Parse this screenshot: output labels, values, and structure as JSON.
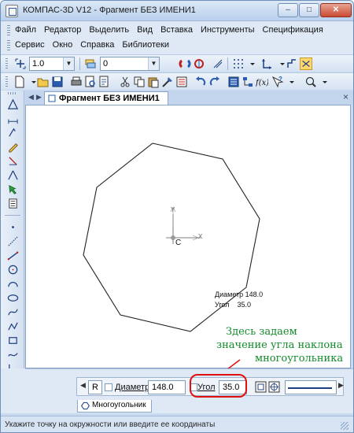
{
  "window": {
    "title": "КОМПАС-3D V12 - Фрагмент БЕЗ ИМЕНИ1",
    "minimize": "–",
    "maximize": "□",
    "close": "✕"
  },
  "menu": {
    "row1": [
      "Файл",
      "Редактор",
      "Выделить",
      "Вид",
      "Вставка",
      "Инструменты",
      "Спецификация"
    ],
    "row2": [
      "Сервис",
      "Окно",
      "Справка",
      "Библиотеки"
    ]
  },
  "toolbar": {
    "line_width": "1.0",
    "layer": "0"
  },
  "document": {
    "tab_label": "Фрагмент БЕЗ ИМЕНИ1",
    "tab_close": "×"
  },
  "canvas": {
    "axis_y": "Y",
    "axis_x": "X",
    "origin": "C",
    "readout_diameter": "Диаметр 148.0",
    "readout_angle": "Угол    35.0"
  },
  "callout": {
    "line1": "Здесь задаем",
    "line2": "значение угла наклона",
    "line3": "многоугольника"
  },
  "properties": {
    "r_button": "R",
    "diameter_label": "Диаметр",
    "diameter_value": "148.0",
    "angle_label": "Угол",
    "angle_value": "35.0",
    "tab_label": "Многоугольник"
  },
  "status": {
    "text": "Укажите точку на окружности или введите ее координаты"
  },
  "icons": {
    "stop": "stop-icon",
    "auto": "auto-icon",
    "camera": "camera-icon",
    "polygon": "polygon-icon"
  },
  "colors": {
    "callout": "#128a2a",
    "highlight": "#e01010",
    "accent": "#2a5cb0"
  }
}
